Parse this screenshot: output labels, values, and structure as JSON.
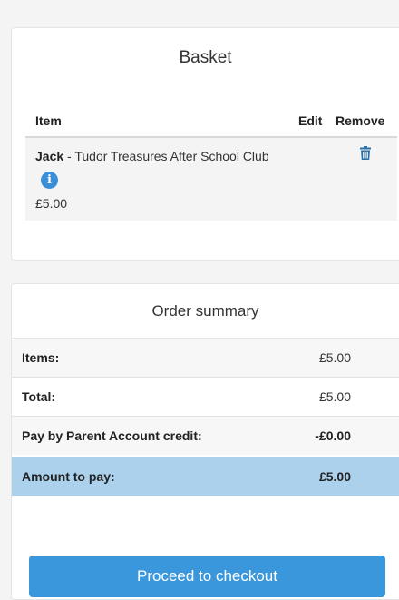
{
  "basket": {
    "title": "Basket",
    "columns": {
      "item": "Item",
      "edit": "Edit",
      "remove": "Remove"
    },
    "items": [
      {
        "name": "Jack",
        "separator": " - ",
        "description": "Tudor Treasures After School Club",
        "price": "£5.00",
        "info_icon": "i"
      }
    ]
  },
  "summary": {
    "title": "Order summary",
    "rows": [
      {
        "label": "Items:",
        "value": "£5.00"
      },
      {
        "label": "Total:",
        "value": "£5.00"
      },
      {
        "label": "Pay by Parent Account credit:",
        "value": "-£0.00"
      },
      {
        "label": "Amount to pay:",
        "value": "£5.00"
      }
    ]
  },
  "checkout": {
    "label": "Proceed to checkout"
  },
  "colors": {
    "accent": "#3b97dc",
    "highlight_row": "#acd1ec",
    "info_icon": "#3a8fd6",
    "trash_icon": "#2a6fa8"
  },
  "icons": {
    "info": "info-icon",
    "remove": "trash-icon"
  }
}
